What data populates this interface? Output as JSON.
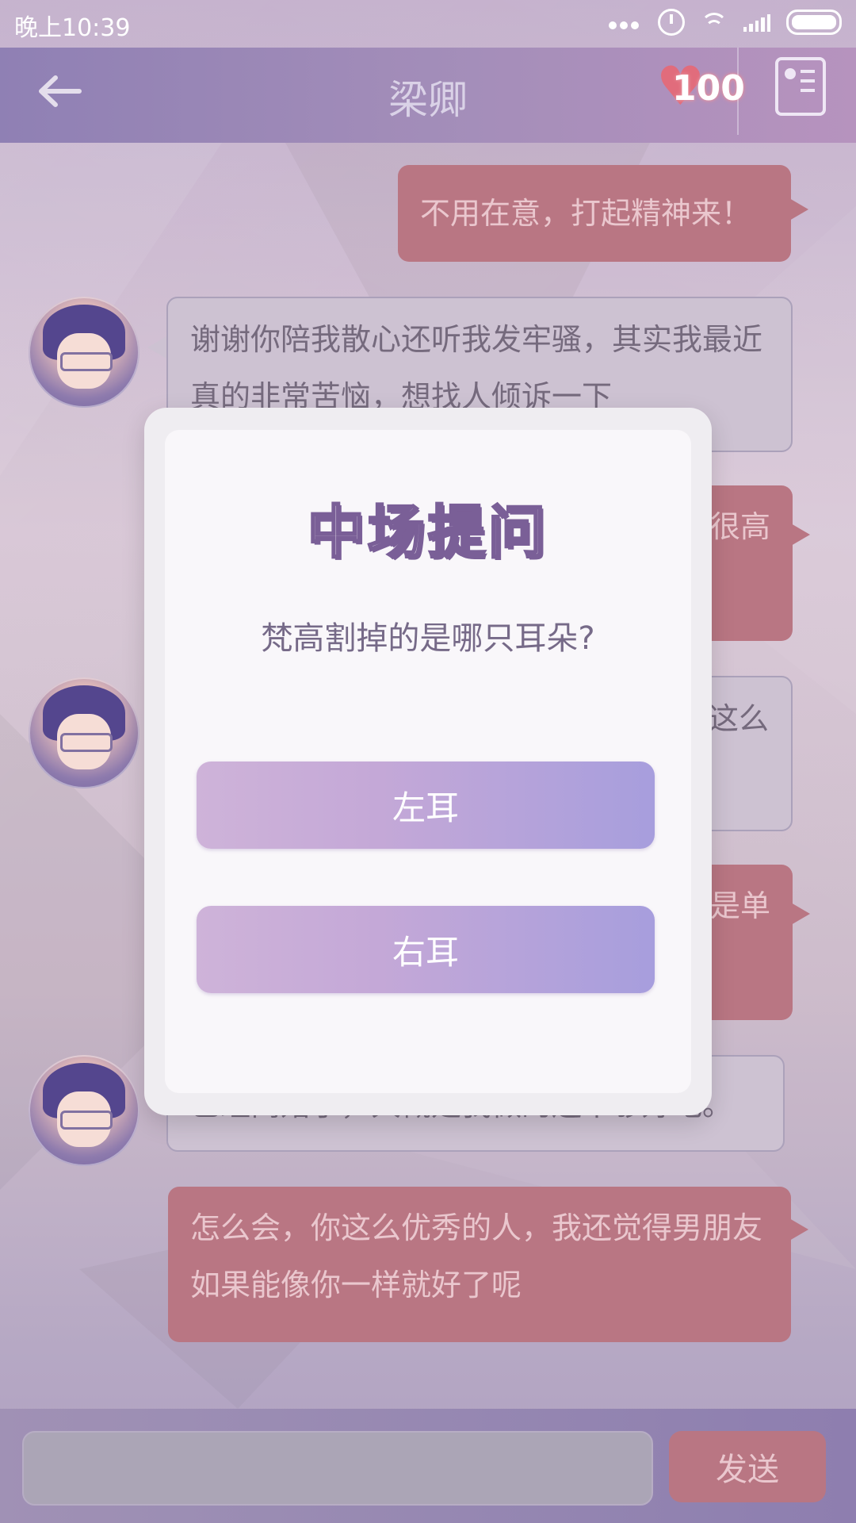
{
  "status_bar": {
    "time": "晚上10:39"
  },
  "header": {
    "title": "梁卿",
    "affection_value": "100",
    "icons": {
      "back": "back-arrow-icon",
      "affection": "heart-icon",
      "contact": "contact-card-icon"
    }
  },
  "messages": [
    {
      "side": "right",
      "text": "不用在意，打起精神来！"
    },
    {
      "side": "left",
      "text": "谢谢你陪我散心还听我发牢骚，其实我最近真的非常苦恼，想找人倾诉一下"
    },
    {
      "side": "right",
      "text": "很高"
    },
    {
      "side": "left",
      "text": "这么"
    },
    {
      "side": "right",
      "text": "是单"
    },
    {
      "side": "left",
      "text": "已经离婚了，大概是我做的还不够好吧。"
    },
    {
      "side": "right",
      "text": "怎么会，你这么优秀的人，我还觉得男朋友如果能像你一样就好了呢"
    }
  ],
  "input_bar": {
    "send_label": "发送"
  },
  "modal": {
    "title": "中场提问",
    "question": "梵高割掉的是哪只耳朵?",
    "options": [
      {
        "label": "左耳"
      },
      {
        "label": "右耳"
      }
    ]
  },
  "colors": {
    "user_bubble": "#b66f7d",
    "npc_bubble": "#cbbfd0",
    "header_bg": "#9b86b5",
    "modal_bg": "#f9f7fa",
    "option_gradient_start": "#ceb3d9",
    "option_gradient_end": "#a79edd"
  }
}
